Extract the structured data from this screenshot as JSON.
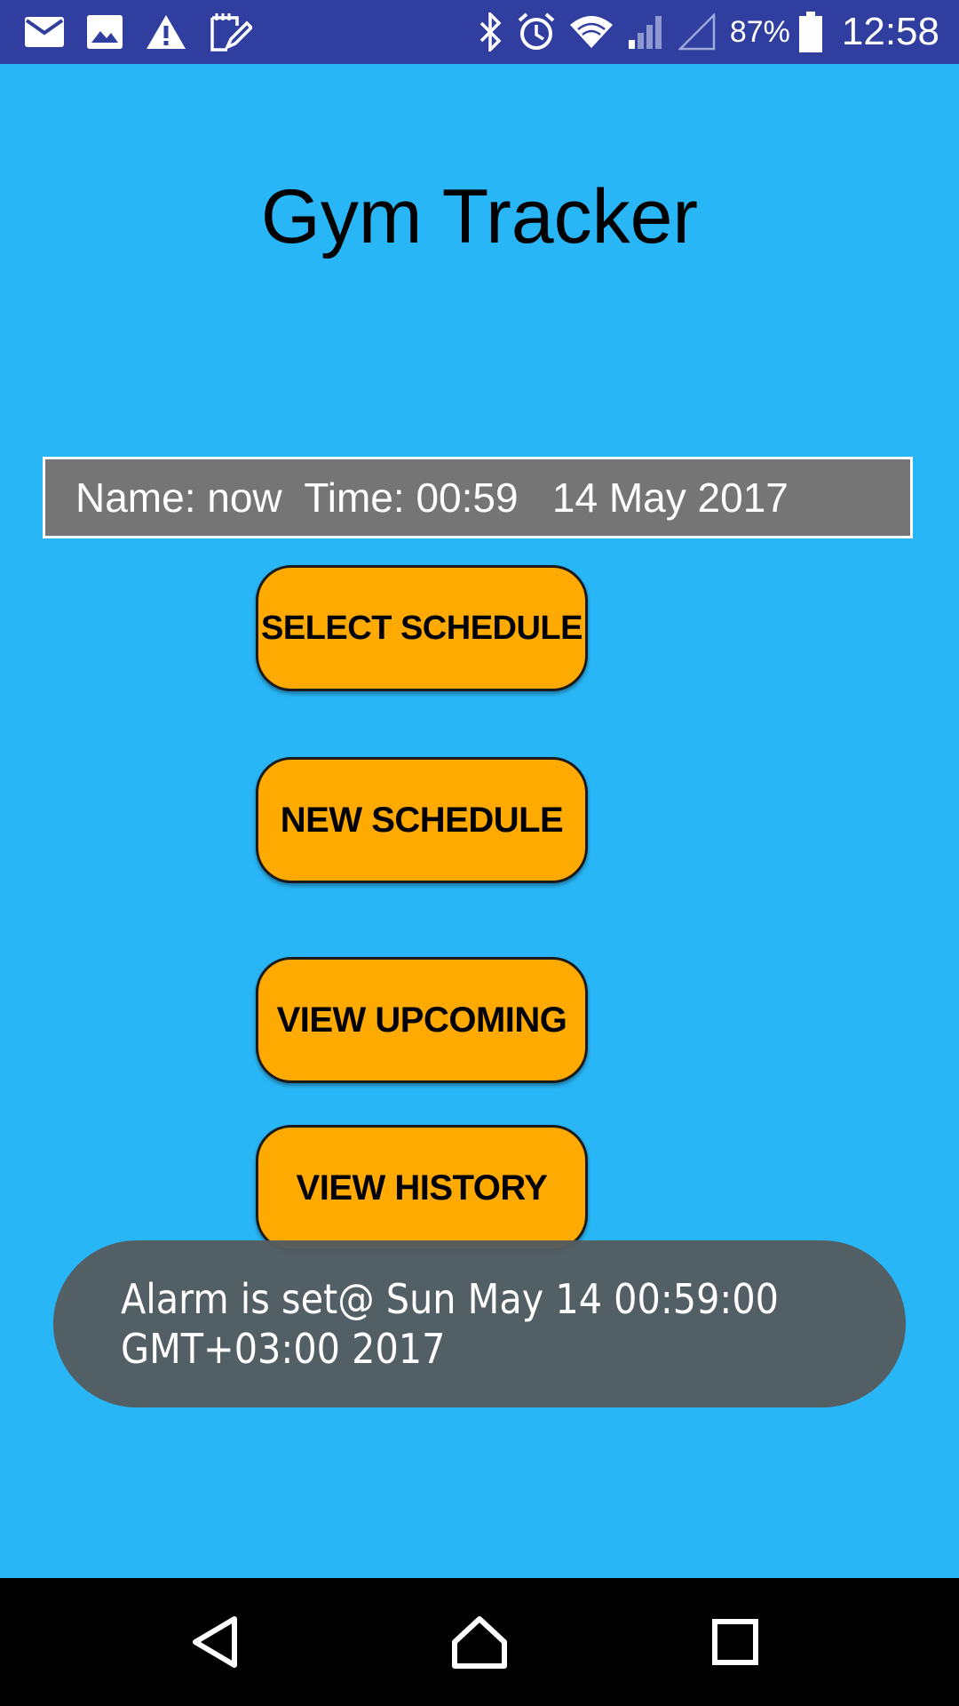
{
  "status_bar": {
    "battery_percent": "87%",
    "time": "12:58",
    "icons": [
      "mail-icon",
      "image-icon",
      "warning-icon",
      "note-edit-icon",
      "bluetooth-icon",
      "alarm-icon",
      "wifi-icon",
      "signal-icon",
      "signal-empty-icon",
      "battery-icon"
    ]
  },
  "app": {
    "title": "Gym Tracker",
    "info_line": "Name: now  Time: 00:59   14 May 2017"
  },
  "buttons": {
    "select_schedule": "SELECT SCHEDULE",
    "new_schedule": "NEW SCHEDULE",
    "view_upcoming": "VIEW UPCOMING",
    "view_history": "VIEW HISTORY"
  },
  "toast": {
    "line1": "Alarm is set@ Sun May 14 00:59:00",
    "line2": "GMT+03:00 2017"
  },
  "nav": {
    "icons": [
      "back-icon",
      "home-icon",
      "recents-icon"
    ]
  },
  "colors": {
    "background": "#29b6f6",
    "status_bar": "#303f9f",
    "button": "#ffaa00",
    "info_box": "#757575",
    "toast": "#545c60",
    "nav_bar": "#000000"
  }
}
